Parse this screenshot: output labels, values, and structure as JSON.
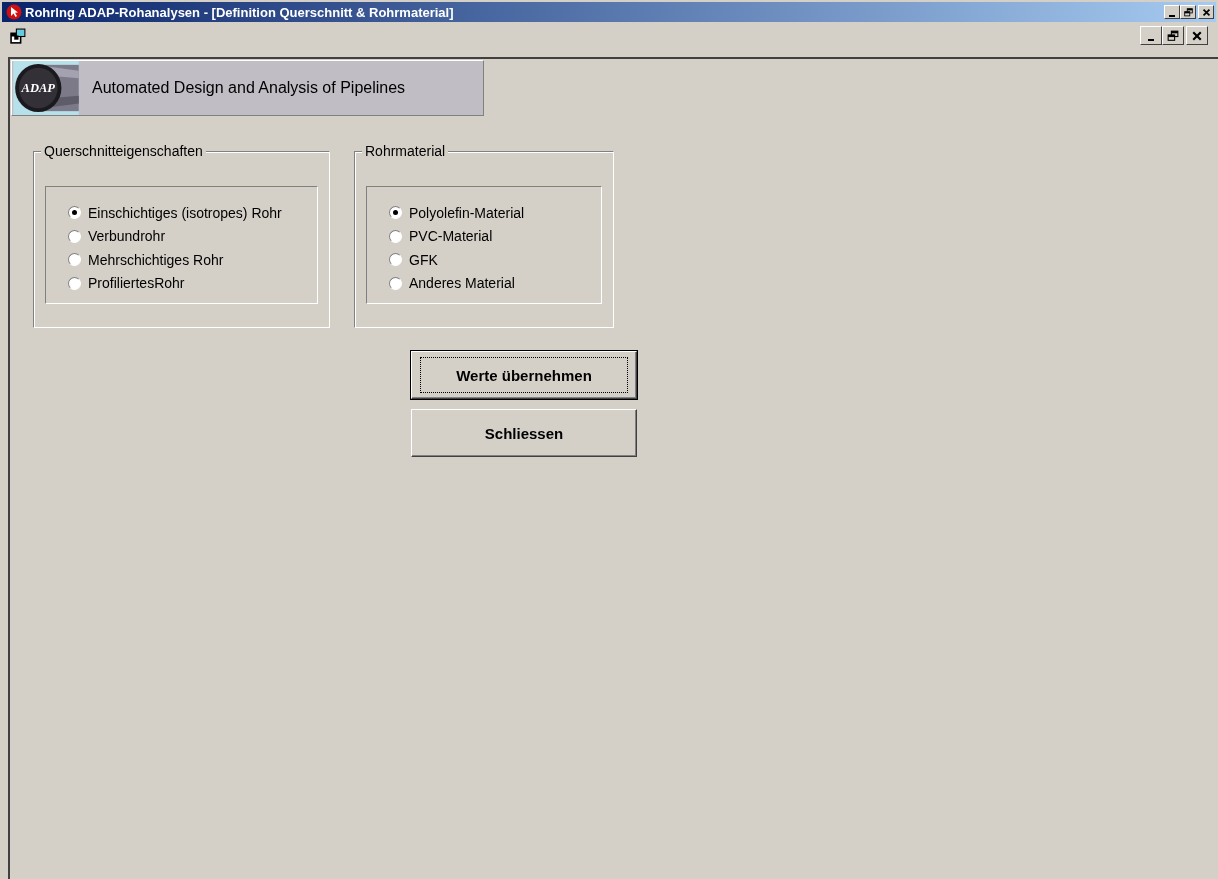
{
  "window": {
    "title": "Rohrlng ADAP-Rohanalysen - [Definition Querschnitt & Rohrmaterial]"
  },
  "banner": {
    "logo_text": "ADAP",
    "title": "Automated Design and Analysis of Pipelines"
  },
  "groups": [
    {
      "title": "Querschnitteigenschaften",
      "options": [
        {
          "label": "Einschichtiges (isotropes) Rohr",
          "selected": true
        },
        {
          "label": "Verbundrohr",
          "selected": false
        },
        {
          "label": "Mehrschichtiges Rohr",
          "selected": false
        },
        {
          "label": "ProfiliertesRohr",
          "selected": false
        }
      ]
    },
    {
      "title": "Rohrmaterial",
      "options": [
        {
          "label": "Polyolefin-Material",
          "selected": true
        },
        {
          "label": "PVC-Material",
          "selected": false
        },
        {
          "label": "GFK",
          "selected": false
        },
        {
          "label": "Anderes Material",
          "selected": false
        }
      ]
    }
  ],
  "buttons": [
    {
      "label": "Werte übernehmen",
      "default": true
    },
    {
      "label": "Schliessen",
      "default": false
    }
  ]
}
